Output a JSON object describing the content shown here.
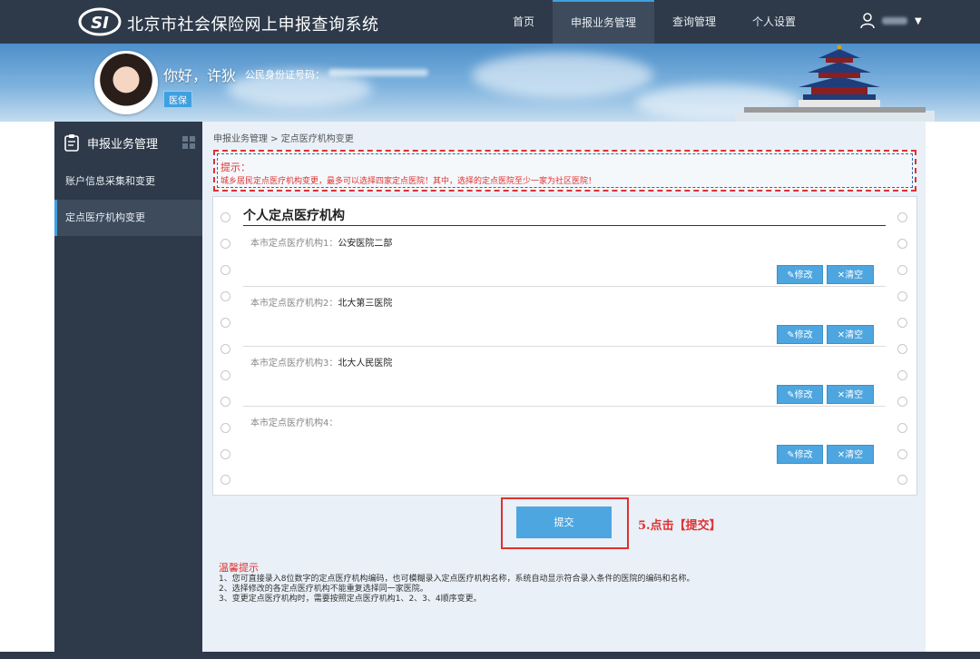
{
  "header": {
    "system_title": "北京市社会保险网上申报查询系统",
    "nav": [
      {
        "label": "首页",
        "active": false
      },
      {
        "label": "申报业务管理",
        "active": true
      },
      {
        "label": "查询管理",
        "active": false
      },
      {
        "label": "个人设置",
        "active": false
      }
    ],
    "user_caret": "▼"
  },
  "banner": {
    "greeting": "你好，许狄",
    "id_label": "公民身份证号码：",
    "badge": "医保"
  },
  "sidebar": {
    "section_title": "申报业务管理",
    "items": [
      {
        "label": "账户信息采集和变更",
        "active": false
      },
      {
        "label": "定点医疗机构变更",
        "active": true
      }
    ]
  },
  "main": {
    "breadcrumb": "申报业务管理 > 定点医疗机构变更",
    "hint_title": "提示：",
    "hint_text": "城乡居民定点医疗机构变更，最多可以选择四家定点医院！其中，选择的定点医院至少一家为社区医院！",
    "card_title": "个人定点医疗机构",
    "institutions": [
      {
        "label": "本市定点医疗机构1：",
        "value": "公安医院二部"
      },
      {
        "label": "本市定点医疗机构2：",
        "value": "北大第三医院"
      },
      {
        "label": "本市定点医疗机构3：",
        "value": "北大人民医院"
      },
      {
        "label": "本市定点医疗机构4：",
        "value": ""
      }
    ],
    "edit_label": "✎修改",
    "clear_label": "✕清空",
    "submit_label": "提交",
    "step_note": "5.点击【提交】",
    "tips_title": "温馨提示",
    "tips": [
      "1、您可直接录入8位数字的定点医疗机构编码，也可模糊录入定点医疗机构名称，系统自动显示符合录入条件的医院的编码和名称。",
      "2、选择修改的各定点医疗机构不能重复选择同一家医院。",
      "3、变更定点医疗机构时，需要按照定点医疗机构1、2、3、4顺序变更。"
    ]
  },
  "colors": {
    "nav_bg": "#2e3a4a",
    "accent": "#4ea6e0",
    "alert": "#e03030"
  }
}
